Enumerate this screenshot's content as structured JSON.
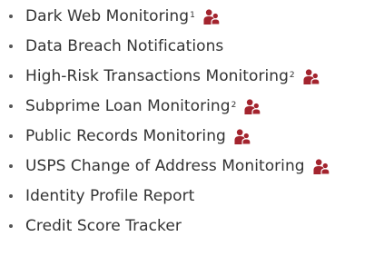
{
  "accent_color": "#a3242e",
  "features": [
    {
      "label": "Dark Web Monitoring",
      "footnote": "1",
      "icon": "family-icon"
    },
    {
      "label": "Data Breach Notifications",
      "footnote": "",
      "icon": ""
    },
    {
      "label": "High-Risk Transactions Monitoring",
      "footnote": "2",
      "icon": "family-icon"
    },
    {
      "label": "Subprime Loan Monitoring",
      "footnote": "2",
      "icon": "family-icon"
    },
    {
      "label": "Public Records Monitoring",
      "footnote": "",
      "icon": "family-icon"
    },
    {
      "label": "USPS Change of Address Monitoring",
      "footnote": "",
      "icon": "family-icon"
    },
    {
      "label": "Identity Profile Report",
      "footnote": "",
      "icon": ""
    },
    {
      "label": "Credit Score Tracker",
      "footnote": "",
      "icon": ""
    }
  ]
}
